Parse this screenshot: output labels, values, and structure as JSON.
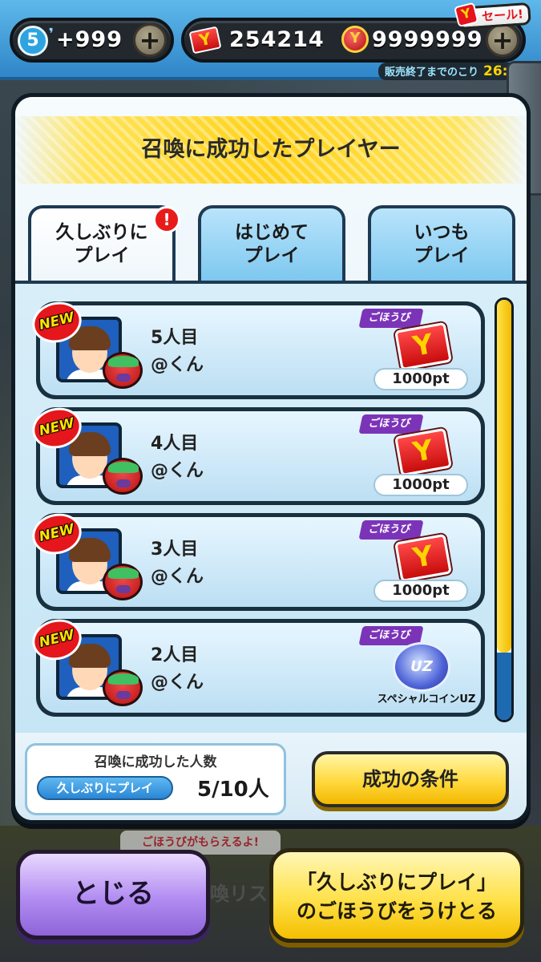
{
  "topbar": {
    "level": "5",
    "stamina": "+999",
    "tickets": "254214",
    "money": "9999999",
    "sale_label": "セール!",
    "timer_label": "販売終了までのこり",
    "timer_value": "26:"
  },
  "modal": {
    "title": "召喚に成功したプレイヤー",
    "tabs": [
      {
        "line1": "久しぶりに",
        "line2": "プレイ",
        "active": true
      },
      {
        "line1": "はじめて",
        "line2": "プレイ",
        "active": false
      },
      {
        "line1": "いつも",
        "line2": "プレイ",
        "active": false
      }
    ],
    "tab_badge": "!",
    "rows": [
      {
        "new": "NEW",
        "count": "5人目",
        "name": "@くん",
        "reward_label": "ごほうび",
        "reward_icon": "ticket-icon",
        "reward_value": "1000pt"
      },
      {
        "new": "NEW",
        "count": "4人目",
        "name": "@くん",
        "reward_label": "ごほうび",
        "reward_icon": "ticket-icon",
        "reward_value": "1000pt"
      },
      {
        "new": "NEW",
        "count": "3人目",
        "name": "@くん",
        "reward_label": "ごほうび",
        "reward_icon": "ticket-icon",
        "reward_value": "1000pt"
      },
      {
        "new": "NEW",
        "count": "2人目",
        "name": "@くん",
        "reward_label": "ごほうび",
        "reward_icon": "special-coin-icon",
        "reward_value": "スペシャルコインUZ",
        "coin_text": "UZ"
      }
    ],
    "success_count": {
      "title": "召喚に成功した人数",
      "category": "久しぶりにプレイ",
      "value": "5/10人"
    },
    "condition_button": "成功の条件"
  },
  "buttons": {
    "close": "とじる",
    "claim_line1": "「久しぶりにプレイ」",
    "claim_line2": "のごほうびをうけとる",
    "bg_hint": "ごほうびがもらえるよ!",
    "bg_list": "喚リス"
  },
  "colors": {
    "accent_yellow": "#ffd21a",
    "close_purple": "#b28cf1",
    "reward_purple": "#7b34b8",
    "new_red": "#e5161c"
  }
}
